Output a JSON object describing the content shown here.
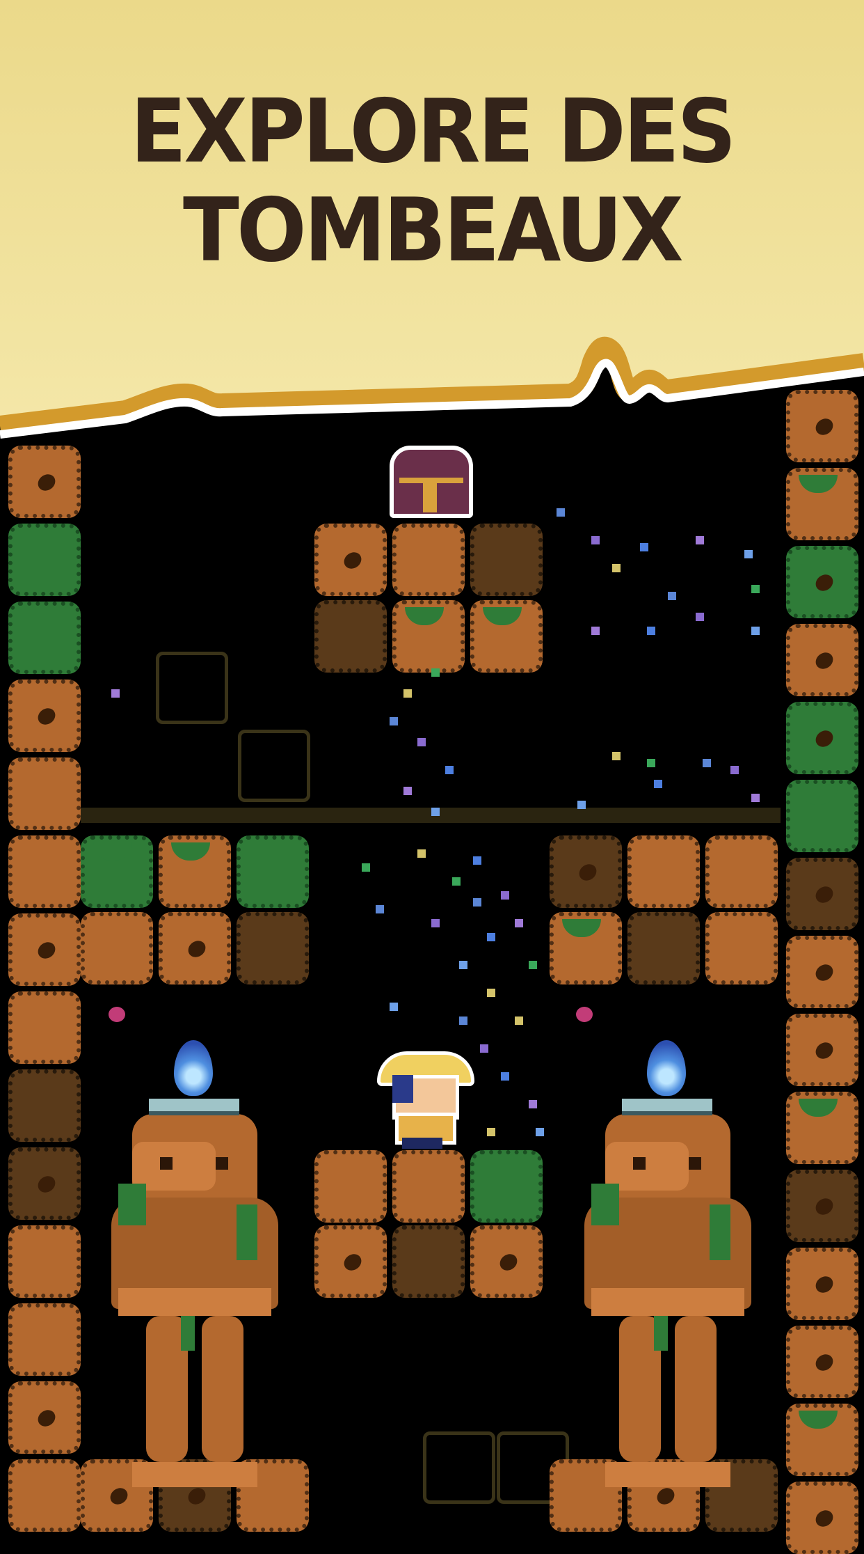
{
  "headline": {
    "line1": "EXPLORE DES",
    "line2": "TOMBEAUX"
  },
  "colors": {
    "banner": "#f1e39a",
    "banner_edge": "#d39a2c",
    "text": "#33231a",
    "dirt": "#b4692f",
    "moss": "#2f7c38",
    "background": "#000000"
  },
  "scene": {
    "treasure_chest": "chest",
    "player": "explorer",
    "statues": [
      "statue-left",
      "statue-right"
    ],
    "braziers": [
      "blue-flame-left",
      "blue-flame-right"
    ]
  }
}
